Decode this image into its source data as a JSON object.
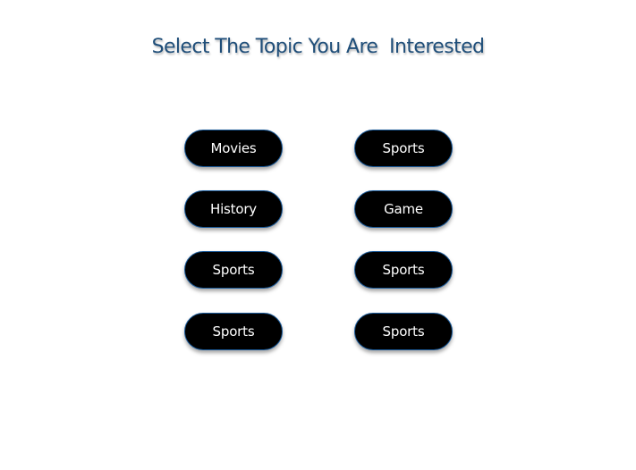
{
  "title": "Select The Topic You Are  Interested",
  "topics": [
    {
      "label": "Movies"
    },
    {
      "label": "Sports"
    },
    {
      "label": "History"
    },
    {
      "label": "Game"
    },
    {
      "label": "Sports"
    },
    {
      "label": "Sports"
    },
    {
      "label": "Sports"
    },
    {
      "label": "Sports"
    }
  ],
  "colors": {
    "title": "#1f4e79",
    "button_bg": "#000000",
    "button_border": "#1a5a9a",
    "button_text": "#ffffff",
    "background": "#ffffff"
  }
}
